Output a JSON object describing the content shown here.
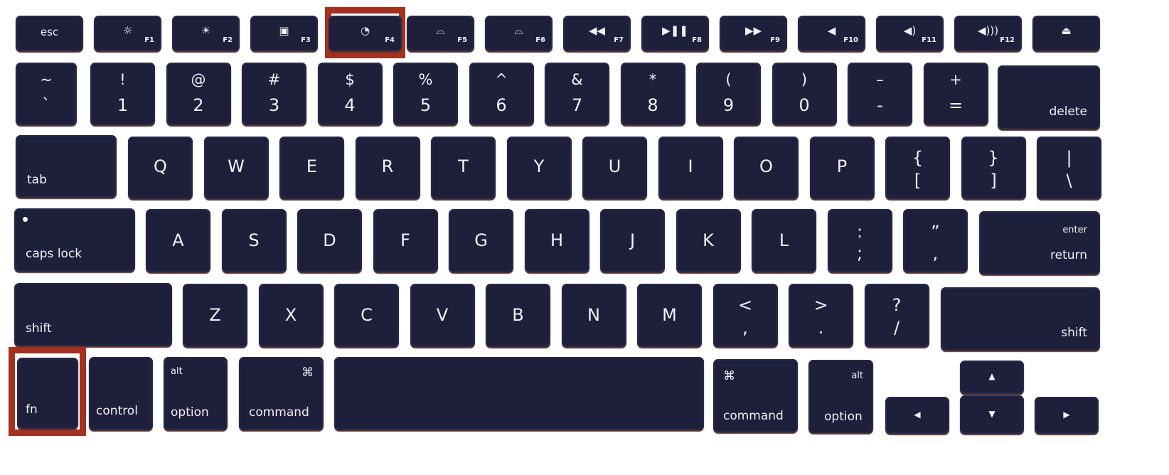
{
  "highlight_color": "#a4301f",
  "key_color": "#1d1f3b",
  "highlighted_keys": [
    "F4",
    "fn"
  ],
  "function_row": [
    {
      "label": "esc"
    },
    {
      "fkey": "F1",
      "icon": "☼",
      "icon_name": "brightness-down-icon"
    },
    {
      "fkey": "F2",
      "icon": "☀",
      "icon_name": "brightness-up-icon"
    },
    {
      "fkey": "F3",
      "icon": "▣",
      "icon_name": "mission-control-icon"
    },
    {
      "fkey": "F4",
      "icon": "◔",
      "icon_name": "dashboard-icon"
    },
    {
      "fkey": "F5",
      "icon": "⌓",
      "icon_name": "keyboard-light-down-icon"
    },
    {
      "fkey": "F6",
      "icon": "⌓",
      "icon_name": "keyboard-light-up-icon"
    },
    {
      "fkey": "F7",
      "icon": "◀◀",
      "icon_name": "rewind-icon"
    },
    {
      "fkey": "F8",
      "icon": "▶❚❚",
      "icon_name": "play-pause-icon"
    },
    {
      "fkey": "F9",
      "icon": "▶▶",
      "icon_name": "fast-forward-icon"
    },
    {
      "fkey": "F10",
      "icon": "◀",
      "icon_name": "mute-icon"
    },
    {
      "fkey": "F11",
      "icon": "◀)",
      "icon_name": "volume-down-icon"
    },
    {
      "fkey": "F12",
      "icon": "◀)))",
      "icon_name": "volume-up-icon"
    },
    {
      "icon": "⏏",
      "icon_name": "eject-icon"
    }
  ],
  "number_row": [
    {
      "top": "~",
      "bottom": "`"
    },
    {
      "top": "!",
      "bottom": "1"
    },
    {
      "top": "@",
      "bottom": "2"
    },
    {
      "top": "#",
      "bottom": "3"
    },
    {
      "top": "$",
      "bottom": "4"
    },
    {
      "top": "%",
      "bottom": "5"
    },
    {
      "top": "^",
      "bottom": "6"
    },
    {
      "top": "&",
      "bottom": "7"
    },
    {
      "top": "*",
      "bottom": "8"
    },
    {
      "top": "(",
      "bottom": "9"
    },
    {
      "top": ")",
      "bottom": "0"
    },
    {
      "top": "–",
      "bottom": "-"
    },
    {
      "top": "+",
      "bottom": "="
    },
    {
      "label": "delete"
    }
  ],
  "q_row": [
    {
      "label": "tab"
    },
    {
      "label": "Q"
    },
    {
      "label": "W"
    },
    {
      "label": "E"
    },
    {
      "label": "R"
    },
    {
      "label": "T"
    },
    {
      "label": "Y"
    },
    {
      "label": "U"
    },
    {
      "label": "I"
    },
    {
      "label": "O"
    },
    {
      "label": "P"
    },
    {
      "top": "{",
      "bottom": "["
    },
    {
      "top": "}",
      "bottom": "]"
    },
    {
      "top": "|",
      "bottom": "\\"
    }
  ],
  "a_row": [
    {
      "label": "caps lock"
    },
    {
      "label": "A"
    },
    {
      "label": "S"
    },
    {
      "label": "D"
    },
    {
      "label": "F"
    },
    {
      "label": "G"
    },
    {
      "label": "H"
    },
    {
      "label": "J"
    },
    {
      "label": "K"
    },
    {
      "label": "L"
    },
    {
      "top": ":",
      "bottom": ";"
    },
    {
      "top": "”",
      "bottom": ","
    },
    {
      "top": "enter",
      "bottom": "return"
    }
  ],
  "z_row": [
    {
      "label": "shift"
    },
    {
      "label": "Z"
    },
    {
      "label": "X"
    },
    {
      "label": "C"
    },
    {
      "label": "V"
    },
    {
      "label": "B"
    },
    {
      "label": "N"
    },
    {
      "label": "M"
    },
    {
      "top": "<",
      "bottom": ","
    },
    {
      "top": ">",
      "bottom": "."
    },
    {
      "top": "?",
      "bottom": "/"
    },
    {
      "label": "shift"
    }
  ],
  "bottom_row": [
    {
      "label": "fn"
    },
    {
      "label": "control"
    },
    {
      "top": "alt",
      "bottom": "option"
    },
    {
      "top": "⌘",
      "bottom": "command"
    },
    {
      "label": ""
    },
    {
      "top": "⌘",
      "bottom": "command"
    },
    {
      "top": "alt",
      "bottom": "option"
    },
    {
      "icon": "◀",
      "icon_name": "arrow-left-icon"
    },
    {
      "icon": "▲",
      "icon_name": "arrow-up-icon"
    },
    {
      "icon": "▼",
      "icon_name": "arrow-down-icon"
    },
    {
      "icon": "▶",
      "icon_name": "arrow-right-icon"
    }
  ]
}
